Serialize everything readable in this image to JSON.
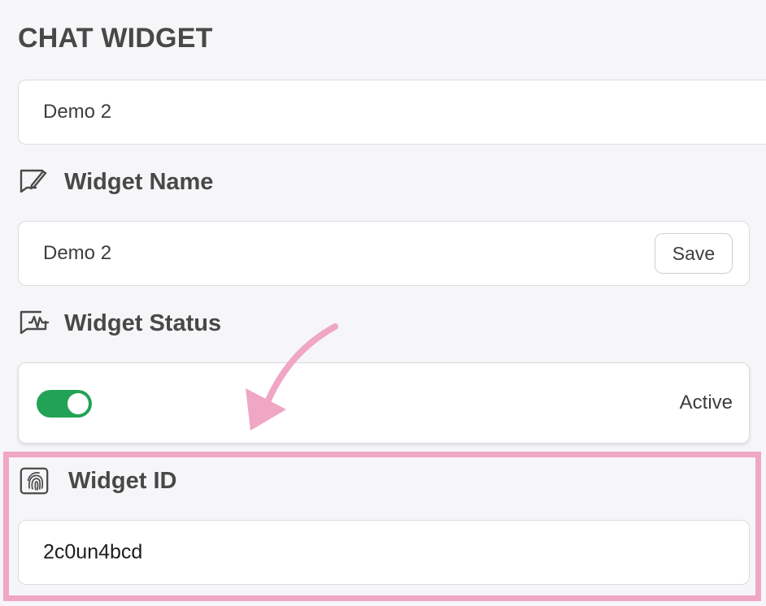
{
  "page": {
    "title": "CHAT WIDGET"
  },
  "top_field": {
    "value": "Demo 2"
  },
  "widget_name": {
    "label": "Widget Name",
    "value": "Demo 2",
    "save_label": "Save",
    "icon": "edit-message-icon"
  },
  "widget_status": {
    "label": "Widget Status",
    "status_text": "Active",
    "enabled": true,
    "icon": "activity-message-icon",
    "toggle_color": "#21a355"
  },
  "widget_id": {
    "label": "Widget ID",
    "value": "2c0un4bcd",
    "icon": "fingerprint-icon"
  },
  "annotation": {
    "highlight_color": "#f0a7c4",
    "arrow_color": "#f0a7c4"
  }
}
